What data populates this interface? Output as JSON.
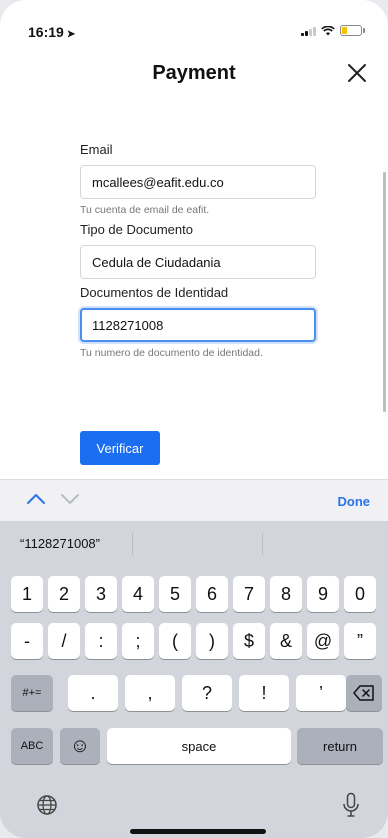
{
  "status_bar": {
    "time": "16:19",
    "location_arrow": "➤"
  },
  "header": {
    "title": "Payment",
    "close_label": "✕"
  },
  "form": {
    "email": {
      "label": "Email",
      "value": "mcallees@eafit.edu.co",
      "helper": "Tu cuenta de email de eafit."
    },
    "doc_type": {
      "label": "Tipo de Documento",
      "value": "Cedula de Ciudadania"
    },
    "doc_id": {
      "label": "Documentos de Identidad",
      "value": "1128271008",
      "helper": "Tu numero de documento de identidad."
    },
    "verify_label": "Verificar"
  },
  "accessory_bar": {
    "done_label": "Done"
  },
  "keyboard": {
    "suggestion": "“1128271008”",
    "row1": [
      "1",
      "2",
      "3",
      "4",
      "5",
      "6",
      "7",
      "8",
      "9",
      "0"
    ],
    "row2": [
      "-",
      "/",
      ":",
      ";",
      "(",
      ")",
      "$",
      "&",
      "@",
      "”"
    ],
    "row3_toggle": "#+=",
    "row3": [
      ".",
      ",",
      "?",
      "!",
      "’"
    ],
    "abc_label": "ABC",
    "emoji_label": "☺",
    "space_label": "space",
    "return_label": "return"
  },
  "colors": {
    "accent": "#1b6ef0",
    "focus_border": "#4a8ef0",
    "keyboard_bg": "#d2d5db"
  }
}
